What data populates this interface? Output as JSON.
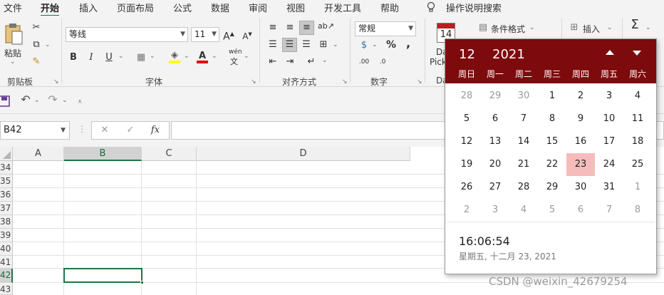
{
  "menu": {
    "tabs": [
      "文件",
      "开始",
      "插入",
      "页面布局",
      "公式",
      "数据",
      "审阅",
      "视图",
      "开发工具",
      "帮助"
    ],
    "tell_me": "操作说明搜索"
  },
  "ribbon": {
    "clipboard": {
      "paste_label": "粘贴",
      "group_label": "剪贴板"
    },
    "font": {
      "font_name": "等线",
      "font_size": "11",
      "group_label": "字体",
      "bold": "B",
      "italic": "I",
      "underline": "U",
      "phonetic_top": "wén",
      "phonetic_bottom": "文"
    },
    "alignment": {
      "group_label": "对齐方式"
    },
    "number": {
      "format": "常规",
      "percent": "%",
      "comma": ",",
      "group_label": "数字"
    },
    "styles": {
      "conditional_format": "条件格式"
    },
    "cells": {
      "insert": "插入"
    },
    "editing": {
      "sum_symbol": "Σ"
    },
    "datepicker_group": {
      "calendar_day": "14",
      "line1": "Da",
      "line2": "Pick",
      "group_short": "Da"
    }
  },
  "formula_bar": {
    "name_box": "B42",
    "fx": "fx"
  },
  "grid": {
    "columns": [
      "A",
      "B",
      "C",
      "D"
    ],
    "selected_column": "B",
    "rows": [
      "34",
      "35",
      "36",
      "37",
      "38",
      "39",
      "40",
      "41",
      "42",
      "43"
    ],
    "selected_row": "42"
  },
  "datepicker": {
    "month": "12",
    "year": "2021",
    "weekdays": [
      "周日",
      "周一",
      "周二",
      "周三",
      "周四",
      "周五",
      "周六"
    ],
    "weeks": [
      [
        "28",
        "29",
        "30",
        "1",
        "2",
        "3",
        "4"
      ],
      [
        "5",
        "6",
        "7",
        "8",
        "9",
        "10",
        "11"
      ],
      [
        "12",
        "13",
        "14",
        "15",
        "16",
        "17",
        "18"
      ],
      [
        "19",
        "20",
        "21",
        "22",
        "23",
        "24",
        "25"
      ],
      [
        "26",
        "27",
        "28",
        "29",
        "30",
        "31",
        "1"
      ],
      [
        "2",
        "3",
        "4",
        "5",
        "6",
        "7",
        "8"
      ]
    ],
    "time": "16:06:54",
    "long_date": "星期五, 十二月 23, 2021",
    "colors": {
      "header": "#7d0a0c",
      "today": "#f6bcbc"
    }
  },
  "watermark": "CSDN @weixin_42679254"
}
